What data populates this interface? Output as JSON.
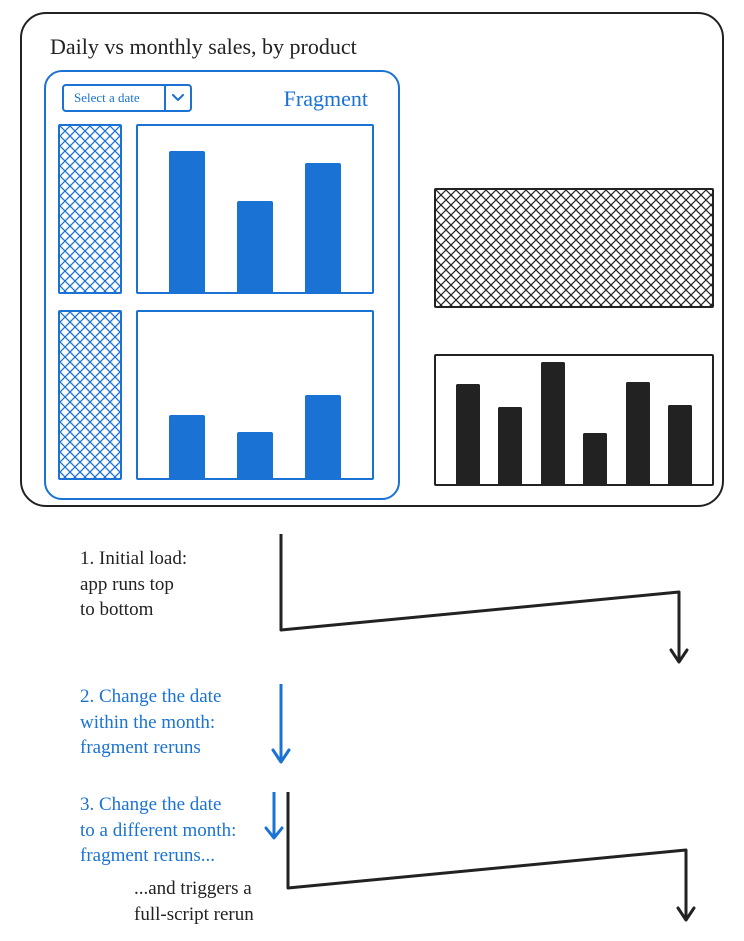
{
  "title": "Daily vs monthly sales, by product",
  "fragment": {
    "label": "Fragment",
    "select_placeholder": "Select a date"
  },
  "steps": {
    "s1": "1. Initial load:\napp runs top\nto bottom",
    "s2": "2. Change the date\nwithin the month:\nfragment reruns",
    "s3a": "3. Change the date\nto a different month:\nfragment reruns...",
    "s3b": "...and triggers a\nfull-script rerun"
  },
  "chart_data": [
    {
      "type": "bar",
      "name": "fragment-chart-1",
      "values": [
        85,
        55,
        78
      ],
      "ylim": [
        0,
        100
      ]
    },
    {
      "type": "bar",
      "name": "fragment-chart-2",
      "values": [
        38,
        28,
        50
      ],
      "ylim": [
        0,
        100
      ]
    },
    {
      "type": "bar",
      "name": "right-chart",
      "values": [
        78,
        60,
        95,
        40,
        80,
        62
      ],
      "ylim": [
        0,
        100
      ]
    }
  ],
  "colors": {
    "accent": "#1a72d4",
    "ink": "#222222"
  }
}
